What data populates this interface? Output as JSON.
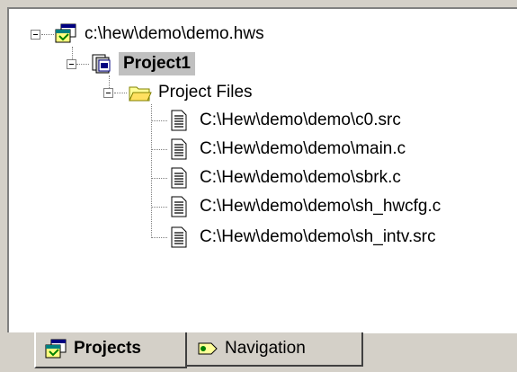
{
  "tree": {
    "workspace": {
      "label": "c:\\hew\\demo\\demo.hws",
      "icon": "workspace-icon"
    },
    "project": {
      "label": "Project1",
      "icon": "project-icon"
    },
    "folder": {
      "label": "Project Files",
      "icon": "folder-open-icon"
    },
    "files": [
      {
        "label": "C:\\Hew\\demo\\demo\\c0.src",
        "icon": "document-icon"
      },
      {
        "label": "C:\\Hew\\demo\\demo\\main.c",
        "icon": "document-icon"
      },
      {
        "label": "C:\\Hew\\demo\\demo\\sbrk.c",
        "icon": "document-icon"
      },
      {
        "label": "C:\\Hew\\demo\\demo\\sh_hwcfg.c",
        "icon": "document-icon"
      },
      {
        "label": "C:\\Hew\\demo\\demo\\sh_intv.src",
        "icon": "document-icon"
      }
    ]
  },
  "tabs": [
    {
      "label": "Projects",
      "icon": "projects-icon",
      "active": true
    },
    {
      "label": "Navigation",
      "icon": "navigation-icon",
      "active": false
    }
  ]
}
